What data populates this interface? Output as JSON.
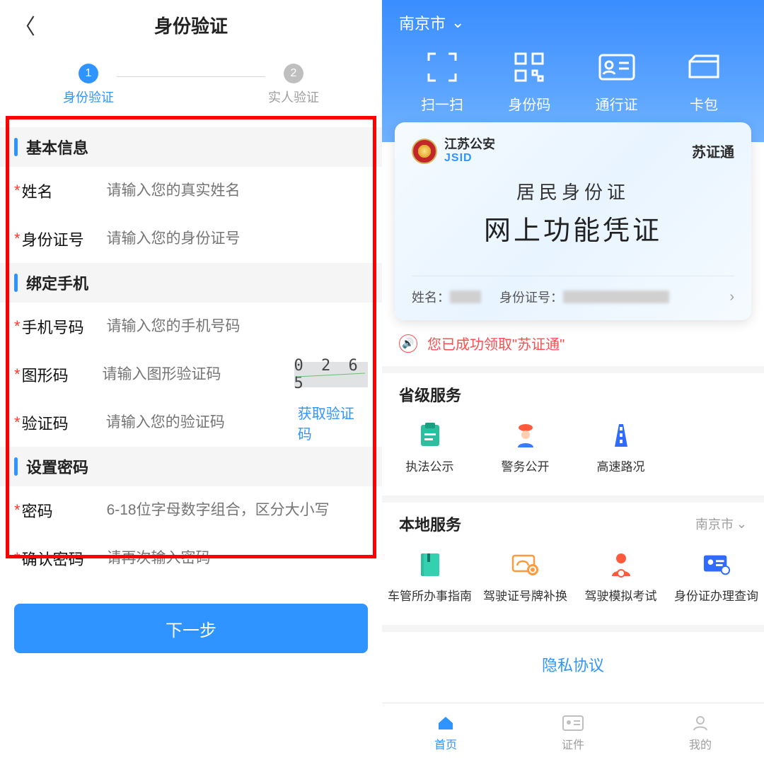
{
  "left": {
    "title": "身份验证",
    "steps": {
      "s1": {
        "num": "1",
        "label": "身份验证"
      },
      "s2": {
        "num": "2",
        "label": "实人验证"
      }
    },
    "sections": {
      "basic": "基本信息",
      "phone": "绑定手机",
      "pwd": "设置密码"
    },
    "fields": {
      "name": {
        "label": "姓名",
        "ph": "请输入您的真实姓名"
      },
      "idno": {
        "label": "身份证号",
        "ph": "请输入您的身份证号"
      },
      "mobile": {
        "label": "手机号码",
        "ph": "请输入您的手机号码"
      },
      "imgcode": {
        "label": "图形码",
        "ph": "请输入图形验证码"
      },
      "smscode": {
        "label": "验证码",
        "ph": "请输入您的验证码"
      },
      "pwd": {
        "label": "密码",
        "ph": "6-18位字母数字组合，区分大小写"
      },
      "confirmpwd": {
        "label": "确认密码",
        "ph": "请再次输入密码"
      }
    },
    "captcha": "0 2 6 5",
    "getCode": "获取验证码",
    "nextBtn": "下一步"
  },
  "right": {
    "location": "南京市",
    "topActions": {
      "scan": "扫一扫",
      "idcode": "身份码",
      "pass": "通行证",
      "wallet": "卡包"
    },
    "card": {
      "org1": "江苏公安",
      "org2": "JSID",
      "tag": "苏证通",
      "line1": "居民身份证",
      "line2": "网上功能凭证",
      "nameLabel": "姓名：",
      "idLabel": "身份证号："
    },
    "successMsg": "您已成功领取\"苏证通\"",
    "provTitle": "省级服务",
    "prov": {
      "a": "执法公示",
      "b": "警务公开",
      "c": "高速路况"
    },
    "localTitle": "本地服务",
    "localLoc": "南京市",
    "local": {
      "a": "车管所办事指南",
      "b": "驾驶证号牌补换",
      "c": "驾驶模拟考试",
      "d": "身份证办理查询"
    },
    "privacy": "隐私协议",
    "tabs": {
      "home": "首页",
      "cert": "证件",
      "mine": "我的"
    }
  }
}
